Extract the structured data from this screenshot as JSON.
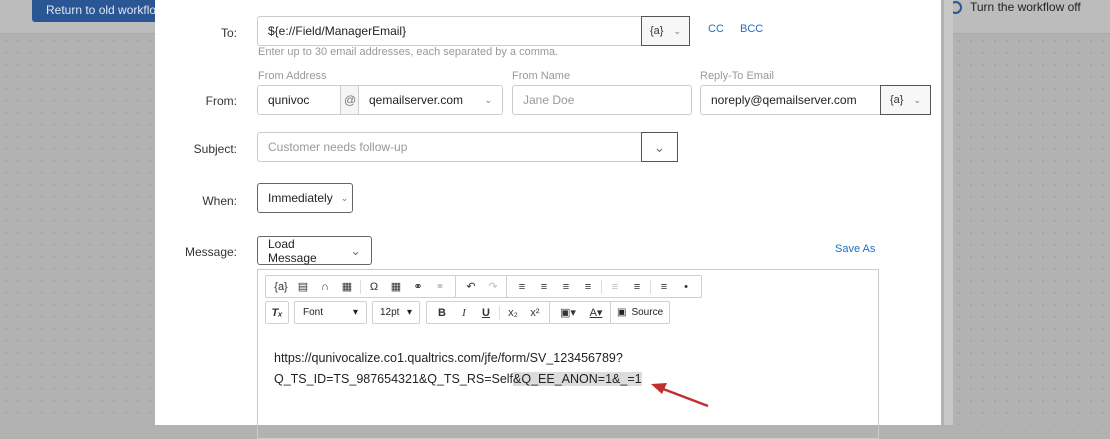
{
  "background": {
    "return_button": "Return to old workflow",
    "workflow_toggle": "Turn the workflow off"
  },
  "form": {
    "to": {
      "label": "To:",
      "value": "${e://Field/ManagerEmail}",
      "piped_text": "{a}",
      "hint": "Enter up to 30 email addresses, each separated by a comma.",
      "cc": "CC",
      "bcc": "BCC"
    },
    "from": {
      "label": "From:",
      "address_label": "From Address",
      "address_value": "qunivoc",
      "at": "@",
      "domain_value": "qemailserver.com",
      "name_label": "From Name",
      "name_placeholder": "Jane Doe",
      "reply_label": "Reply-To Email",
      "reply_value": "noreply@qemailserver.com",
      "piped_text": "{a}"
    },
    "subject": {
      "label": "Subject:",
      "placeholder": "Customer needs follow-up"
    },
    "when": {
      "label": "When:",
      "value": "Immediately"
    },
    "message": {
      "label": "Message:",
      "load": "Load Message",
      "save_as": "Save As"
    }
  },
  "editor": {
    "font": "Font",
    "size": "12pt",
    "source": "Source",
    "line1": "https://qunivocalize.co1.qualtrics.com/jfe/form/SV_123456789?",
    "line2_plain": "Q_TS_ID=TS_987654321&Q_TS_RS=Self",
    "line2_highlighted": "&Q_EE_ANON=1&_=1"
  },
  "colors": {
    "link": "#1f6fc0",
    "arrow": "#c0302f",
    "button": "#2a5694"
  }
}
